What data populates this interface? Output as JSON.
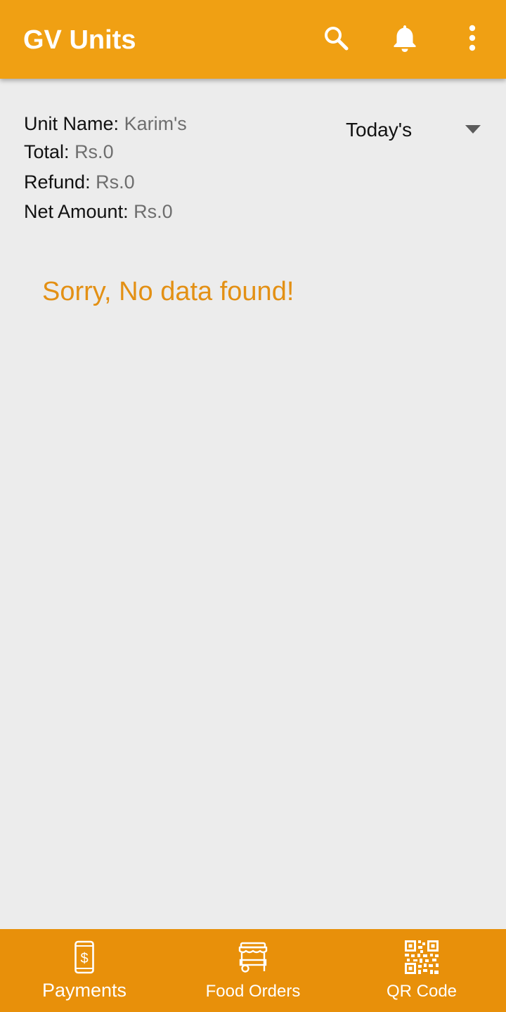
{
  "appbar": {
    "title": "GV Units",
    "icons": [
      "search-icon",
      "bell-icon",
      "more-vert-icon"
    ]
  },
  "summary": {
    "unit_name_label": "Unit Name:",
    "unit_name_value": "Karim's",
    "total_label": "Total:",
    "total_value": "Rs.0",
    "refund_label": "Refund:",
    "refund_value": "Rs.0",
    "net_amount_label": "Net Amount:",
    "net_amount_value": "Rs.0"
  },
  "period_filter": {
    "selected": "Today's"
  },
  "empty_state": {
    "message": "Sorry, No data found!"
  },
  "bottom_nav": {
    "items": [
      {
        "label": "Payments",
        "icon": "mobile-payment-icon",
        "active": true
      },
      {
        "label": "Food Orders",
        "icon": "food-cart-icon",
        "active": false
      },
      {
        "label": "QR Code",
        "icon": "qr-code-icon",
        "active": false
      }
    ]
  },
  "colors": {
    "appbar": "#f0a013",
    "bottom_nav": "#e8900a",
    "empty_message": "#e39014",
    "background": "#ececec"
  }
}
